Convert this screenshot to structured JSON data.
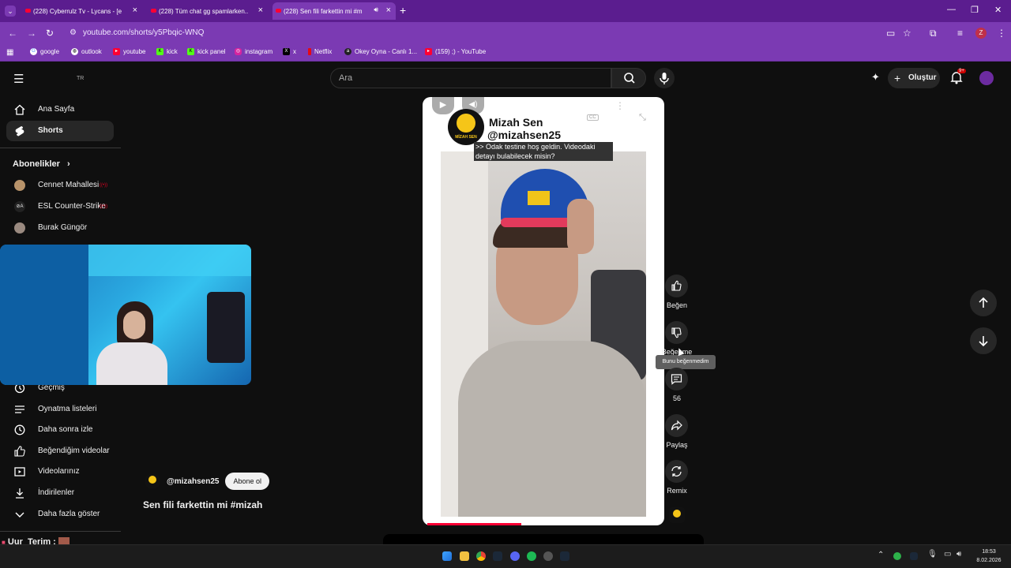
{
  "browser": {
    "tabs": [
      {
        "title": "(228) Cyberrulz Tv - Lycans - [e",
        "active": false
      },
      {
        "title": "(228) Tüm chat gg spamlarken..",
        "active": false
      },
      {
        "title": "(228) Sen fili farkettin mi #m",
        "active": true
      }
    ],
    "new_tab": "+",
    "url": "youtube.com/shorts/y5Pbqic-WNQ",
    "bookmarks": [
      "google",
      "outlook",
      "youtube",
      "kick",
      "kick panel",
      "instagram",
      "x",
      "Netflix",
      "Okey Oyna - Canlı 1...",
      "(159) ;) - YouTube"
    ],
    "profile_initial": "Z"
  },
  "header": {
    "country": "TR",
    "search_placeholder": "Ara",
    "create_label": "Oluştur",
    "notifications_badge": "9+"
  },
  "sidebar": {
    "items": [
      {
        "label": "Ana Sayfa"
      },
      {
        "label": "Shorts",
        "selected": true
      }
    ],
    "subscriptions_title": "Abonelikler",
    "subscriptions": [
      {
        "label": "Cennet Mahallesi"
      },
      {
        "label": "ESL Counter-Strike"
      },
      {
        "label": "Burak Güngör"
      }
    ],
    "you_items": [
      {
        "label": "Geçmiş"
      },
      {
        "label": "Oynatma listeleri"
      },
      {
        "label": "Daha sonra izle"
      },
      {
        "label": "Beğendiğim videolar"
      },
      {
        "label": "Videolarınız"
      },
      {
        "label": "İndirilenler"
      },
      {
        "label": "Daha fazla göster"
      }
    ]
  },
  "short": {
    "overlay_channel_name": "Mizah Sen",
    "overlay_handle": "@mizahsen25",
    "logo_text": "MİZAH SEN",
    "cc_label": "CC",
    "caption": ">> Odak testine hoş geldin. Videodaki detayı bulabilecek misin?",
    "channel_handle": "@mizahsen25",
    "subscribe_label": "Abone ol",
    "title": "Sen fili farkettin mi #mizah",
    "progress": 0.39
  },
  "actions": {
    "like_label": "Beğen",
    "dislike_label": "Beğenme",
    "dislike_tooltip": "Bunu beğenmedim",
    "comments_count": "56",
    "share_label": "Paylaş",
    "remix_label": "Remix"
  },
  "stream_overlay": {
    "chat_user": "Uur_Terim :"
  },
  "taskbar": {
    "time": "18:53",
    "date": "8.02.2026"
  }
}
